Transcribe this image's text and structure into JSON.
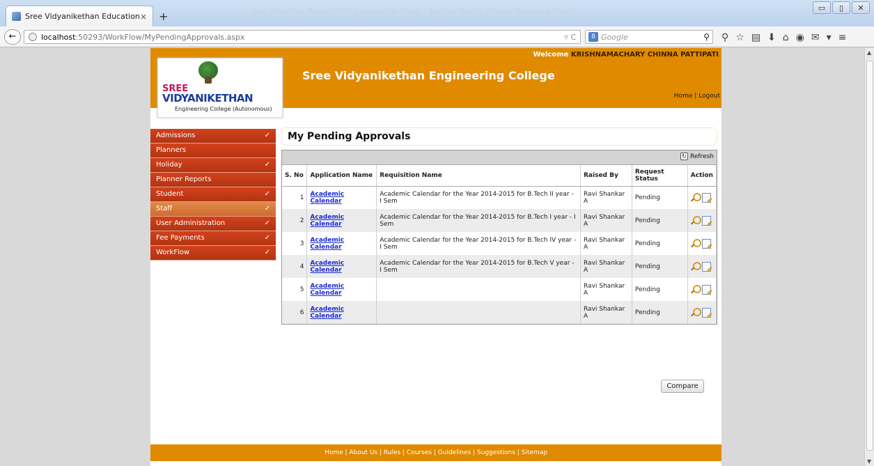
{
  "browser": {
    "tab_title": "Sree Vidyanikethan Educational...",
    "tab_close": "×",
    "new_tab": "+",
    "faded_window_title": "Web Workflow Portal - PDF Compatible Mode - Mozilla Firefox Private Browsing Mode",
    "url_host": "localhost",
    "url_path": ":50293/WorkFlow/MyPendingApprovals.aspx",
    "url_right_icons": "▿ C",
    "search_engine_icon": "8",
    "search_placeholder": "Google",
    "window_buttons": [
      "▭",
      "▯",
      "✕"
    ],
    "toolbar_icons": [
      "⚲",
      "☆",
      "▤",
      "⬇",
      "⌂",
      "◉",
      "✉",
      "▾",
      "≡"
    ]
  },
  "header": {
    "welcome_label": "Welcome",
    "user_name": "KRISHNAMACHARY CHINNA PATTIPATI",
    "college_name": "Sree Vidyanikethan Engineering College",
    "home_link": "Home",
    "separator": "|",
    "logout_link": "Logout",
    "logo": {
      "line1": "SREE",
      "line2": "VIDYANIKETHAN",
      "line3": "Engineering College (Autonomous)"
    }
  },
  "sidebar": {
    "items": [
      {
        "label": "Admissions",
        "chevron": "✓"
      },
      {
        "label": "Planners",
        "chevron": ""
      },
      {
        "label": "Holiday",
        "chevron": "✓"
      },
      {
        "label": "Planner Reports",
        "chevron": ""
      },
      {
        "label": "Student",
        "chevron": "✓"
      },
      {
        "label": "Staff",
        "chevron": "✓"
      },
      {
        "label": "User Administration",
        "chevron": "✓"
      },
      {
        "label": "Fee Payments",
        "chevron": "✓"
      },
      {
        "label": "WorkFlow",
        "chevron": "✓"
      }
    ]
  },
  "main": {
    "title": "My Pending Approvals",
    "refresh_label": "Refresh",
    "columns": [
      "S. No",
      "Application Name",
      "Requisition Name",
      "Raised By",
      "Request Status",
      "Action"
    ],
    "rows": [
      {
        "sno": "1",
        "app": "Academic Calendar",
        "req": "Academic Calendar for the Year 2014-2015 for B.Tech II year - I Sem",
        "raised": "Ravi Shankar A",
        "status": "Pending"
      },
      {
        "sno": "2",
        "app": "Academic Calendar",
        "req": "Academic Calendar for the Year 2014-2015 for B.Tech I year - I Sem",
        "raised": "Ravi Shankar A",
        "status": "Pending"
      },
      {
        "sno": "3",
        "app": "Academic Calendar",
        "req": "Academic Calendar for the Year 2014-2015 for B.Tech IV year - I Sem",
        "raised": "Ravi Shankar A",
        "status": "Pending"
      },
      {
        "sno": "4",
        "app": "Academic Calendar",
        "req": "Academic Calendar for the Year 2014-2015 for B.Tech V year - I Sem",
        "raised": "Ravi Shankar A",
        "status": "Pending"
      },
      {
        "sno": "5",
        "app": "Academic Calendar",
        "req": "",
        "raised": "Ravi Shankar A",
        "status": "Pending"
      },
      {
        "sno": "6",
        "app": "Academic Calendar",
        "req": "",
        "raised": "Ravi Shankar A",
        "status": "Pending"
      }
    ],
    "compare_label": "Compare"
  },
  "footer": {
    "links": "Home  |  About Us  |  Rules  |  Courses  |  Guidelines  |  Suggestions  |  Sitemap"
  },
  "colors": {
    "brand_orange": "#e08a00",
    "menu_red": "#c23a16",
    "link_blue": "#1a2bd6"
  }
}
